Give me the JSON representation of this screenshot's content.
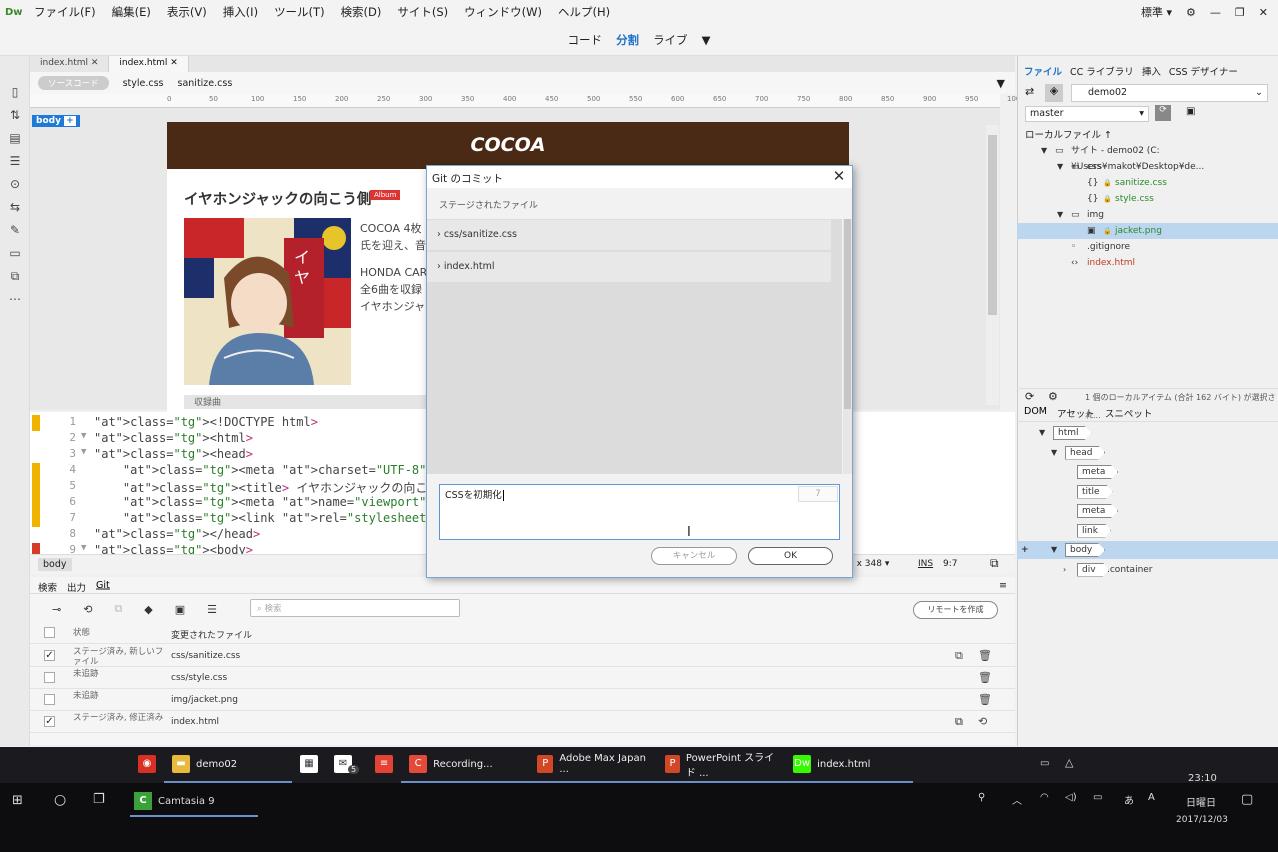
{
  "app": {
    "logo": "Dw",
    "menus": [
      "ファイル(F)",
      "編集(E)",
      "表示(V)",
      "挿入(I)",
      "ツール(T)",
      "検索(D)",
      "サイト(S)",
      "ウィンドウ(W)",
      "ヘルプ(H)"
    ],
    "workspace": "標準",
    "views": [
      "コード",
      "分割",
      "ライブ"
    ],
    "active_view": "分割"
  },
  "doc_tabs": [
    "index.html",
    "index.html"
  ],
  "related": {
    "source": "ソースコード",
    "files": [
      "style.css",
      "sanitize.css"
    ]
  },
  "ruler": [
    "0",
    "50",
    "100",
    "150",
    "200",
    "250",
    "300",
    "350",
    "400",
    "450",
    "500",
    "550",
    "600",
    "650",
    "700",
    "750",
    "800",
    "850",
    "900",
    "950",
    "1000",
    "1050",
    "1100"
  ],
  "design": {
    "body_tag": "body",
    "banner": "COCOA",
    "song_title": "イヤホンジャックの向こう側",
    "badge": "Album",
    "paragraph1": "COCOA 4枚氏を迎え、音",
    "paragraph2": "HONDA CAR 全6曲を収録 イヤホンジャ",
    "tracks_label": "収録曲"
  },
  "code": {
    "lines": [
      {
        "n": "1",
        "fold": "",
        "text": "<!DOCTYPE html>",
        "mark": "#f0b400"
      },
      {
        "n": "2",
        "fold": "▼",
        "text": "<html>",
        "mark": ""
      },
      {
        "n": "3",
        "fold": "▼",
        "text": "<head>",
        "mark": ""
      },
      {
        "n": "4",
        "fold": "",
        "text": "    <meta charset=\"UTF-8\">",
        "mark": "#f0b400"
      },
      {
        "n": "5",
        "fold": "",
        "text": "    <title> イヤホンジャックの向こう側</title>",
        "mark": "#f0b400"
      },
      {
        "n": "6",
        "fold": "",
        "text": "    <meta name=\"viewport\" content=\"width=dev",
        "mark": "#f0b400"
      },
      {
        "n": "7",
        "fold": "",
        "text": "    <link rel=\"stylesheet\" href=\"css/style.c",
        "mark": "#f0b400"
      },
      {
        "n": "8",
        "fold": "",
        "text": "</head>",
        "mark": ""
      },
      {
        "n": "9",
        "fold": "▼",
        "text": "<body>",
        "mark": "#d83a2a"
      }
    ],
    "status_tag": "body",
    "size": "8 x 348",
    "mode": "INS",
    "cursor": "9:7"
  },
  "bottom_panel": {
    "tabs": [
      "検索",
      "出力",
      "Git"
    ],
    "active_tab": "Git",
    "search_placeholder": "検索",
    "remote_button": "リモートを作成",
    "headers": {
      "status": "状態",
      "file": "変更されたファイル"
    },
    "rows": [
      {
        "status": "ステージ済み, 新しいファイル",
        "file": "css/sanitize.css",
        "checked": true
      },
      {
        "status": "未追跡",
        "file": "css/style.css",
        "checked": false
      },
      {
        "status": "未追跡",
        "file": "img/jacket.png",
        "checked": false
      },
      {
        "status": "ステージ済み, 修正済み",
        "file": "index.html",
        "checked": true
      }
    ]
  },
  "right_panel": {
    "tabs": [
      "ファイル",
      "CC ライブラリ",
      "挿入",
      "CSS デザイナー"
    ],
    "active_tab": "ファイル",
    "site": "demo02",
    "branch": "master",
    "local_files_label": "ローカルファイル",
    "tree": [
      {
        "label": "サイト - demo02 (C:¥Users¥makot¥Desktop¥de...",
        "indent": 1,
        "tw": "▼",
        "icon": "▭",
        "color": "",
        "lock": false
      },
      {
        "label": "css",
        "indent": 2,
        "tw": "▼",
        "icon": "▭",
        "color": "",
        "lock": false
      },
      {
        "label": "sanitize.css",
        "indent": 3,
        "tw": "",
        "icon": "{}",
        "color": "gn",
        "lock": true
      },
      {
        "label": "style.css",
        "indent": 3,
        "tw": "",
        "icon": "{}",
        "color": "gn",
        "lock": true
      },
      {
        "label": "img",
        "indent": 2,
        "tw": "▼",
        "icon": "▭",
        "color": "",
        "lock": false
      },
      {
        "label": "jacket.png",
        "indent": 3,
        "tw": "",
        "icon": "▣",
        "color": "gn",
        "lock": true,
        "sel": true
      },
      {
        "label": ".gitignore",
        "indent": 2,
        "tw": "",
        "icon": "◦",
        "color": "",
        "lock": false
      },
      {
        "label": "index.html",
        "indent": 2,
        "tw": "",
        "icon": "‹›",
        "color": "rd",
        "lock": false
      }
    ],
    "status": "1 個のローカルアイテム (合計 162 バイト) が選択され...",
    "dom_tabs": [
      "DOM",
      "アセット",
      "スニペット"
    ],
    "dom": [
      {
        "label": "html",
        "indent": 0,
        "tw": "▼"
      },
      {
        "label": "head",
        "indent": 1,
        "tw": "▼"
      },
      {
        "label": "meta",
        "indent": 2,
        "tw": ""
      },
      {
        "label": "title",
        "indent": 2,
        "tw": ""
      },
      {
        "label": "meta",
        "indent": 2,
        "tw": ""
      },
      {
        "label": "link",
        "indent": 2,
        "tw": ""
      },
      {
        "label": "body",
        "indent": 1,
        "tw": "▼",
        "sel": true
      },
      {
        "label": "div",
        "indent": 2,
        "tw": "›",
        "extra": ".container"
      }
    ]
  },
  "dialog": {
    "title": "Git のコミット",
    "staged_header": "ステージされたファイル",
    "files": [
      "css/sanitize.css",
      "index.html"
    ],
    "message": "CSSを初期化",
    "counter": "7",
    "cancel": "キャンセル",
    "ok": "OK"
  },
  "taskbar": {
    "apps": [
      {
        "label": "",
        "icon": "chrome-icon",
        "glyph": "◉",
        "bg": "#d93025",
        "running": false
      },
      {
        "label": "demo02",
        "icon": "folder-icon",
        "glyph": "▬",
        "bg": "#e8b93a",
        "running": true
      },
      {
        "label": "",
        "icon": "store-icon",
        "glyph": "▦",
        "bg": "#ffffff",
        "running": false
      },
      {
        "label": "",
        "icon": "mail-icon",
        "glyph": "✉",
        "bg": "#ffffff",
        "running": false
      },
      {
        "label": "",
        "icon": "todoist-icon",
        "glyph": "≡",
        "bg": "#e44232",
        "running": false
      },
      {
        "label": "Recording...",
        "icon": "camtasia-recorder-icon",
        "glyph": "C",
        "bg": "#e44a3a",
        "running": true
      },
      {
        "label": "Adobe Max Japan ...",
        "icon": "powerpoint-icon",
        "glyph": "P",
        "bg": "#d24726",
        "running": true
      },
      {
        "label": "PowerPoint スライド ...",
        "icon": "powerpoint-slide-icon",
        "glyph": "P",
        "bg": "#d24726",
        "running": true
      },
      {
        "label": "index.html",
        "icon": "dreamweaver-icon",
        "glyph": "Dw",
        "bg": "#35fa00",
        "running": true
      }
    ],
    "mail_badge": "5",
    "second_row_app": "Camtasia 9",
    "time": "23:10",
    "day": "日曜日",
    "date": "2017/12/03",
    "ime": "あ"
  }
}
